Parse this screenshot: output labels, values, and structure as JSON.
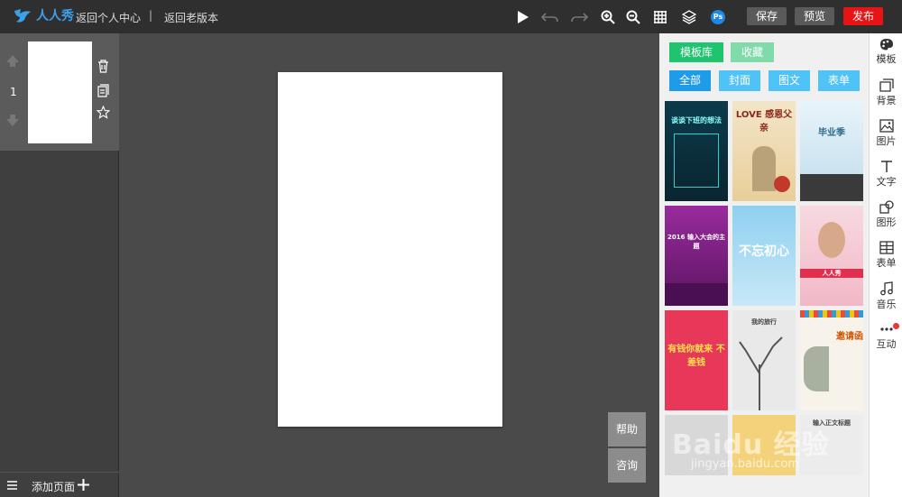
{
  "topbar": {
    "logo_text": "人人秀",
    "back_link": "返回个人中心",
    "separator": "|",
    "old_version_link": "返回老版本",
    "save_label": "保存",
    "preview_label": "预览",
    "publish_label": "发布",
    "ps_label": "Ps"
  },
  "pages": {
    "number": "1",
    "add_label": "添加页面"
  },
  "help": {
    "help_label": "帮助",
    "consult_label": "咨询"
  },
  "panel": {
    "tabs": [
      {
        "label": "模板库"
      },
      {
        "label": "收藏"
      }
    ],
    "categories": [
      {
        "label": "全部"
      },
      {
        "label": "封面"
      },
      {
        "label": "图文"
      },
      {
        "label": "表单"
      }
    ],
    "templates": [
      {
        "title": "谈谈下班的想法"
      },
      {
        "title": "LOVE 感恩父亲"
      },
      {
        "title": "毕业季"
      },
      {
        "title": "2016 输入大会的主题"
      },
      {
        "title": "不忘初心"
      },
      {
        "title": "人人秀"
      },
      {
        "title": "有钱你就来 不差钱"
      },
      {
        "title": "我的旅行"
      },
      {
        "title": "邀请函"
      },
      {
        "title": ""
      },
      {
        "title": ""
      },
      {
        "title": "输入正文标题"
      }
    ]
  },
  "sidebar": {
    "items": [
      {
        "label": "模板"
      },
      {
        "label": "背景"
      },
      {
        "label": "图片"
      },
      {
        "label": "文字"
      },
      {
        "label": "图形"
      },
      {
        "label": "表单"
      },
      {
        "label": "音乐"
      },
      {
        "label": "互动"
      }
    ]
  },
  "watermark": {
    "text": "Baidu 经验",
    "sub": "jingyan.baidu.com"
  },
  "colors": {
    "green": "#1fc46f",
    "light_green": "#7fdcaa",
    "blue_active": "#1e9be9",
    "blue": "#4fc3f7",
    "red": "#e61414",
    "grey_btn": "#5a5a5a"
  }
}
